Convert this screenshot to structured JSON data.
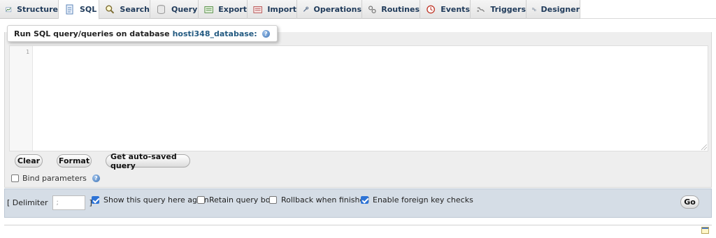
{
  "tabs": [
    {
      "label": "Structure",
      "icon": "structure-icon"
    },
    {
      "label": "SQL",
      "icon": "sql-icon",
      "active": true
    },
    {
      "label": "Search",
      "icon": "search-icon"
    },
    {
      "label": "Query",
      "icon": "query-icon"
    },
    {
      "label": "Export",
      "icon": "export-icon"
    },
    {
      "label": "Import",
      "icon": "import-icon"
    },
    {
      "label": "Operations",
      "icon": "wrench-icon"
    },
    {
      "label": "Routines",
      "icon": "routines-icon"
    },
    {
      "label": "Events",
      "icon": "clock-icon"
    },
    {
      "label": "Triggers",
      "icon": "triggers-icon"
    },
    {
      "label": "Designer",
      "icon": "designer-icon"
    }
  ],
  "sql_panel": {
    "legend_prefix": "Run SQL query/queries on database",
    "database": "hosti348_database:",
    "editor_line": "1",
    "editor_value": ""
  },
  "buttons": {
    "clear": "Clear",
    "format": "Format",
    "autosaved": "Get auto-saved query"
  },
  "bind_parameters": {
    "label": "Bind parameters",
    "checked": false
  },
  "footer": {
    "delimiter_open": "[ Delimiter",
    "delimiter_value": ";",
    "delimiter_close": "]",
    "show_query_again": {
      "label": "Show this query here again",
      "checked": true
    },
    "retain_query_box": {
      "label": "Retain query box",
      "checked": false
    },
    "rollback": {
      "label": "Rollback when finished",
      "checked": false
    },
    "foreign_key_checks": {
      "label": "Enable foreign key checks",
      "checked": true
    },
    "go": "Go"
  },
  "colors": {
    "link": "#235a81",
    "footer_bg": "#d5dde6",
    "panel_bg": "#eeeeee",
    "checkbox_on": "#2d73d6"
  }
}
